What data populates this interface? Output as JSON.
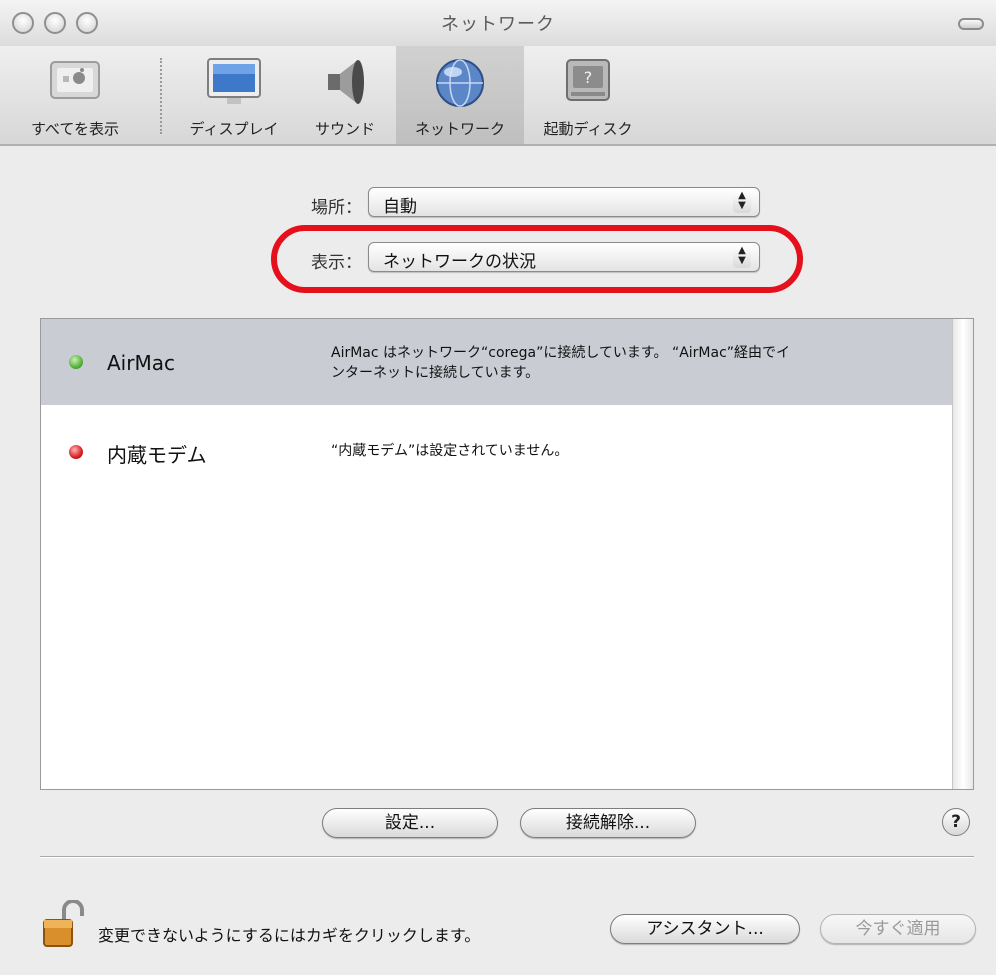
{
  "window": {
    "title": "ネットワーク"
  },
  "toolbar": {
    "items": [
      {
        "label": "すべてを表示",
        "icon": "show-all-icon"
      },
      {
        "label": "ディスプレイ",
        "icon": "display-icon"
      },
      {
        "label": "サウンド",
        "icon": "speaker-icon"
      },
      {
        "label": "ネットワーク",
        "icon": "network-globe-icon",
        "selected": true
      },
      {
        "label": "起動ディスク",
        "icon": "startup-disk-icon"
      }
    ]
  },
  "location": {
    "label": "場所：",
    "value": "自動"
  },
  "show": {
    "label": "表示：",
    "value": "ネットワークの状況"
  },
  "services": [
    {
      "name": "AirMac",
      "status": "green",
      "desc_line1": "AirMac はネットワーク“corega”に接続しています。 “AirMac”経由でイ",
      "desc_line2": "ンターネットに接続しています。"
    },
    {
      "name": "内蔵モデム",
      "status": "red",
      "desc_line1": "“内蔵モデム”は設定されていません。"
    }
  ],
  "buttons": {
    "configure": "設定...",
    "disconnect": "接続解除...",
    "help": "?",
    "assistant": "アシスタント...",
    "apply_now": "今すぐ適用"
  },
  "lock": {
    "text": "変更できないようにするにはカギをクリックします。"
  },
  "colors": {
    "highlight_ring": "#e5101b",
    "selection": "#c9ccd3"
  }
}
